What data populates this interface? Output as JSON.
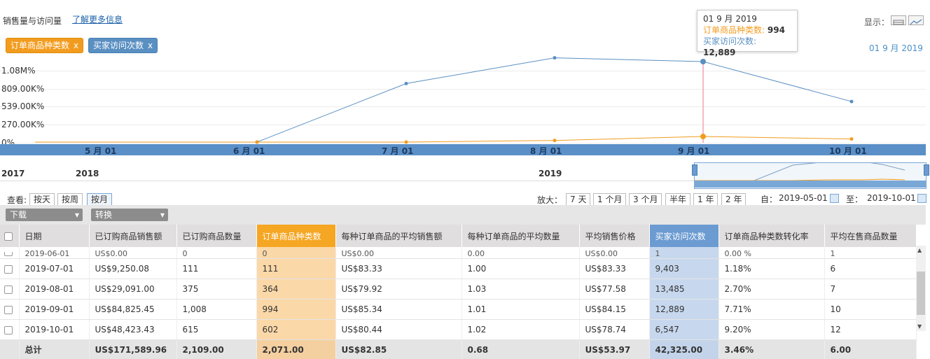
{
  "header": {
    "title": "销售量与访问量",
    "more_link": "了解更多信息",
    "display_label": "显示："
  },
  "chips": {
    "orders": "订单商品种类数",
    "visits": "买家访问次数",
    "close": "x"
  },
  "selected_date_right": "01 9 月 2019",
  "tooltip": {
    "date": "01 9 月 2019",
    "orders_label": "订单商品种类数:",
    "orders_value": "994",
    "visits_label": "买家访问次数:",
    "visits_value": "12,889"
  },
  "chart_data": {
    "type": "line",
    "y_ticks": [
      "1.08M%",
      "809.00K%",
      "539.00K%",
      "270.00K%",
      "0%"
    ],
    "x_ticks": [
      "5 月 01",
      "6 月 01",
      "7 月 01",
      "8 月 01",
      "9 月 01",
      "10 月 01"
    ],
    "series": [
      {
        "name": "买家访问次数",
        "color": "#5a8fc2",
        "values": [
          0,
          0,
          9403,
          13485,
          12889,
          6547
        ]
      },
      {
        "name": "订单商品种类数",
        "color": "#f29c1f",
        "values": [
          0,
          0,
          111,
          364,
          994,
          602
        ]
      }
    ],
    "highlight_index": 4
  },
  "timeline": {
    "years": [
      "2017",
      "2018",
      "2019"
    ]
  },
  "view": {
    "label": "查看:",
    "buttons": [
      "按天",
      "按周",
      "按月"
    ]
  },
  "zoom": {
    "label": "放大：",
    "buttons": [
      "7 天",
      "1 个月",
      "3 个月",
      "半年",
      "1 年",
      "2 年"
    ],
    "from_label": "自：",
    "from_value": "2019-05-01",
    "to_label": "至：",
    "to_value": "2019-10-01"
  },
  "toolbar": {
    "download": "下载",
    "convert": "转换",
    "arrow": "▾"
  },
  "table": {
    "headers": [
      "日期",
      "已订购商品销售额",
      "已订购商品数量",
      "订单商品种类数",
      "每种订单商品的平均销售额",
      "每种订单商品的平均数量",
      "平均销售价格",
      "买家访问次数",
      "订单商品种类数转化率",
      "平均在售商品数量"
    ],
    "partial_row": [
      "2019-06-01",
      "US$0.00",
      "0",
      "0",
      "US$0.00",
      "0.00",
      "US$0.00",
      "1",
      "0.00 %",
      "1"
    ],
    "rows": [
      [
        "2019-07-01",
        "US$9,250.08",
        "111",
        "111",
        "US$83.33",
        "1.00",
        "US$83.33",
        "9,403",
        "1.18%",
        "6"
      ],
      [
        "2019-08-01",
        "US$29,091.00",
        "375",
        "364",
        "US$79.92",
        "1.03",
        "US$77.58",
        "13,485",
        "2.70%",
        "7"
      ],
      [
        "2019-09-01",
        "US$84,825.45",
        "1,008",
        "994",
        "US$85.34",
        "1.01",
        "US$84.15",
        "12,889",
        "7.71%",
        "10"
      ],
      [
        "2019-10-01",
        "US$48,423.43",
        "615",
        "602",
        "US$80.44",
        "1.02",
        "US$78.74",
        "6,547",
        "9.20%",
        "12"
      ]
    ],
    "total": [
      "总计",
      "US$171,589.96",
      "2,109.00",
      "2,071.00",
      "US$82.85",
      "0.68",
      "US$53.97",
      "42,325.00",
      "3.46%",
      "6.00"
    ]
  }
}
